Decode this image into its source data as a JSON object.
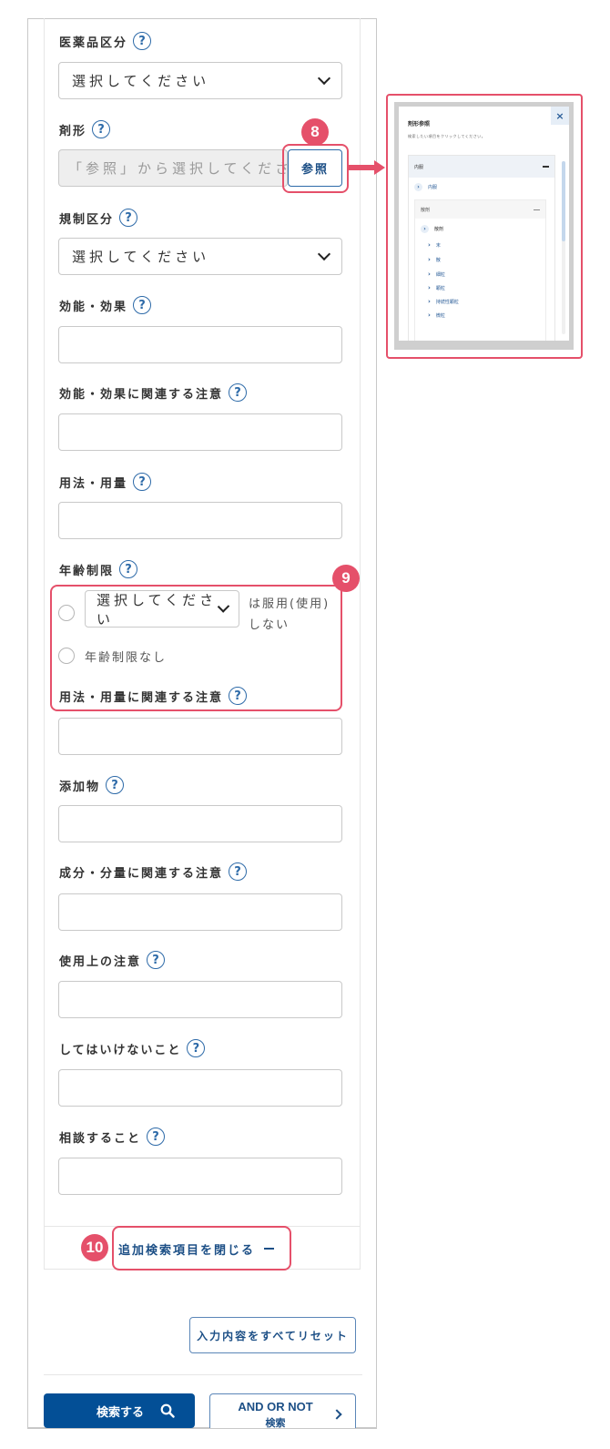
{
  "form": {
    "drug_category": {
      "label": "医薬品区分",
      "help": "?",
      "value": "選択してください"
    },
    "dosage_form": {
      "label": "剤形",
      "help": "?",
      "placeholder": "「参照」から選択してください",
      "ref_button": "参照"
    },
    "regulation_category": {
      "label": "規制区分",
      "help": "?",
      "value": "選択してください"
    },
    "efficacy": {
      "label": "効能・効果",
      "help": "?",
      "value": ""
    },
    "efficacy_notes": {
      "label": "効能・効果に関連する注意",
      "help": "?",
      "value": ""
    },
    "dosage": {
      "label": "用法・用量",
      "help": "?",
      "value": ""
    },
    "age_limit": {
      "label": "年齢制限",
      "help": "?",
      "select_value": "選択してください",
      "suffix_line1": "は服用(使用)",
      "suffix_line2": "しない",
      "no_limit_label": "年齢制限なし"
    },
    "dosage_notes": {
      "label": "用法・用量に関連する注意",
      "help": "?",
      "value": ""
    },
    "additives": {
      "label": "添加物",
      "help": "?",
      "value": ""
    },
    "ingredient_notes": {
      "label": "成分・分量に関連する注意",
      "help": "?",
      "value": ""
    },
    "precautions": {
      "label": "使用上の注意",
      "help": "?",
      "value": ""
    },
    "prohibitions": {
      "label": "してはいけないこと",
      "help": "?",
      "value": ""
    },
    "consultations": {
      "label": "相談すること",
      "help": "?",
      "value": ""
    }
  },
  "close_additional": {
    "label": "追加検索項目を閉じる",
    "icon": "minus-icon"
  },
  "reset_button": "入力内容をすべてリセット",
  "search_button": {
    "label": "検索する",
    "icon": "search-icon"
  },
  "and_or_not_button": {
    "line1": "AND OR NOT",
    "line2": "検索",
    "icon": "chevron-right-icon"
  },
  "callouts": {
    "dosage_form_ref": "8",
    "age_limit": "9",
    "close_additional": "10"
  },
  "popup": {
    "title": "剤形参照",
    "subtitle": "検索したい項目をクリックしてください。",
    "close": "×",
    "section": "内服",
    "section_item": "内服",
    "subsection": "散剤",
    "subsection_item": "散剤",
    "items": [
      "末",
      "散",
      "細粒",
      "顆粒",
      "持続性顆粒",
      "微粒"
    ]
  },
  "colors": {
    "accent": "#e5506a",
    "primary": "#034f96",
    "link": "#1c4f86"
  }
}
